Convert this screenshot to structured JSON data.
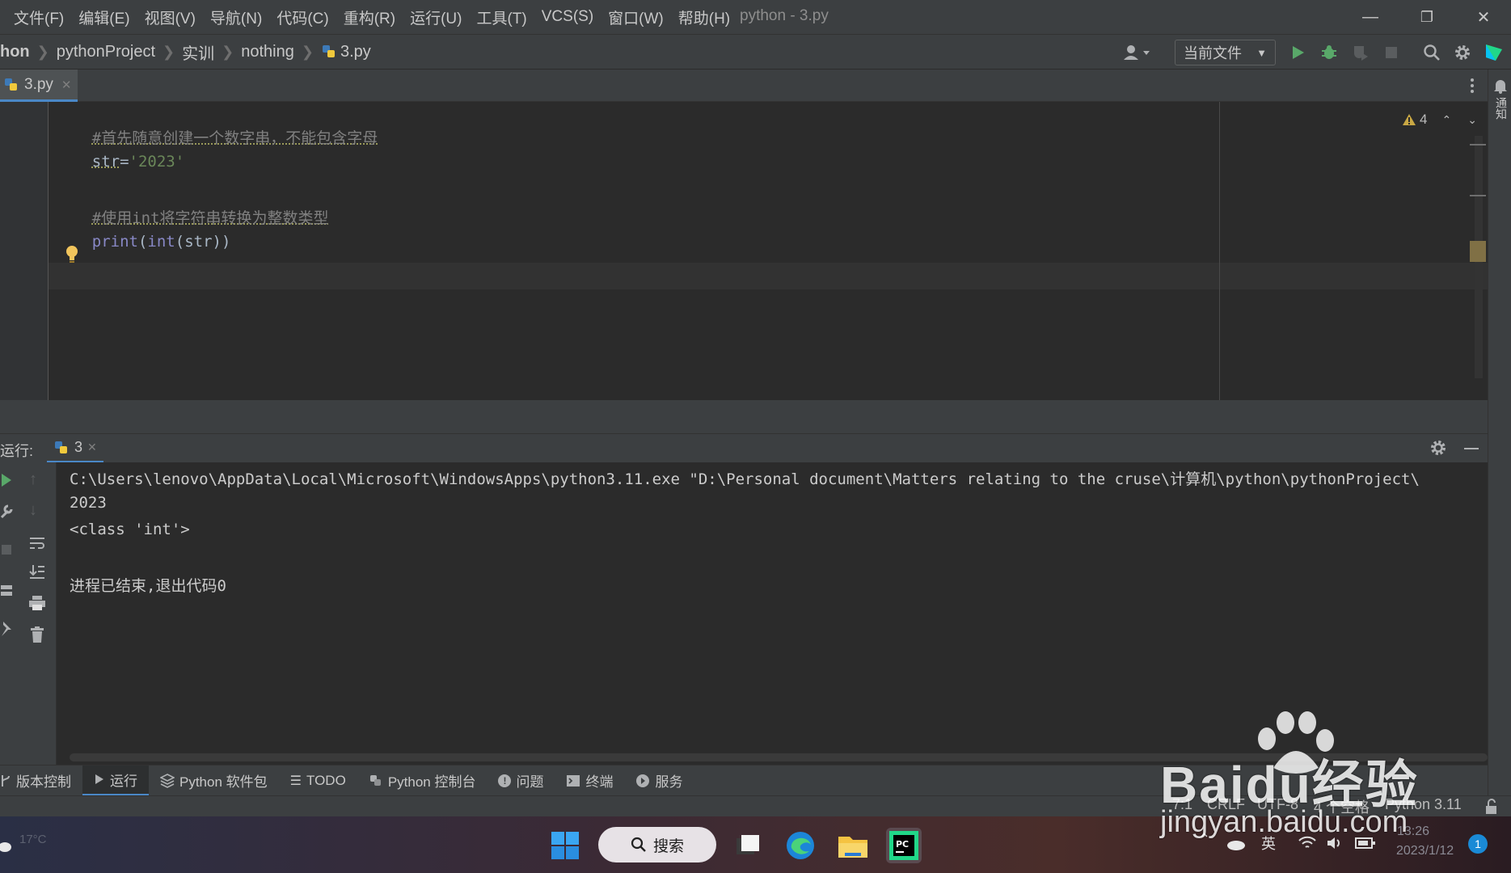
{
  "menubar": {
    "items": [
      "文件(F)",
      "编辑(E)",
      "视图(V)",
      "导航(N)",
      "代码(C)",
      "重构(R)",
      "运行(U)",
      "工具(T)",
      "VCS(S)",
      "窗口(W)",
      "帮助(H)"
    ],
    "window_title": "python - 3.py"
  },
  "navbar": {
    "crumbs": [
      "hon",
      "pythonProject",
      "实训",
      "nothing",
      "3.py"
    ],
    "run_config": "当前文件"
  },
  "editor": {
    "tab_label": "3.py",
    "warning_count": "4",
    "lines": {
      "l1": "#首先随意创建一个数字串，不能包含字母",
      "l2a": "str",
      "l2b": "=",
      "l2c": "'2023'",
      "l4": "#使用int将字符串转换为整数类型",
      "l5a": "print",
      "l5b": "(",
      "l5c": "int",
      "l5d": "(str))"
    }
  },
  "run_panel": {
    "label": "运行:",
    "tab_label": "3",
    "output": [
      "C:\\Users\\lenovo\\AppData\\Local\\Microsoft\\WindowsApps\\python3.11.exe \"D:\\Personal document\\Matters relating to the cruse\\计算机\\python\\pythonProject\\",
      "2023",
      "<class 'int'>",
      "",
      "进程已结束,退出代码0"
    ]
  },
  "bottom_tabs": [
    "版本控制",
    "运行",
    "Python 软件包",
    "TODO",
    "Python 控制台",
    "问题",
    "终端",
    "服务"
  ],
  "statusbar": {
    "position": "7:1",
    "line_sep": "CRLF",
    "encoding": "UTF-8",
    "indent": "4 个空格",
    "interpreter": "Python 3.11"
  },
  "right_stripe": {
    "label": "通知"
  },
  "taskbar": {
    "weather": "17°C",
    "search_label": "搜索",
    "time": "13:26",
    "date": "2023/1/12",
    "ime": "英",
    "notification_count": "1"
  },
  "watermark": {
    "brand": "Baidu经验",
    "url": "jingyan.baidu.com"
  }
}
